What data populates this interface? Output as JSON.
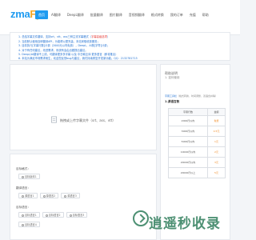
{
  "header": {
    "logo_main": "zma",
    "logo_accent": "Fy",
    "nav": [
      "首页",
      "AI翻译",
      "DeepL翻译",
      "批量翻译",
      "图片翻译",
      "音视频翻译",
      "格式转换",
      "我的订单",
      "充值",
      "帮助"
    ]
  },
  "notice": {
    "lines": [
      "1. 总结字幕文件翻译，支持srt、vtt、ass三种主流字幕格式（",
      "2. 当前默认使用自研翻译API，为能得以更完善，本站采取收费服务；",
      "3. 目前执行[字幕行数]计费（2000元以内免费），DeepL、AI按[字符]计费；",
      "4. 对于有任何建议，改进需求，系统有会由出题提出建议。",
      "5. DeepL/AI翻译不上线，可翻译更多多字幕 以及 中日韩互译 更多语言（即将推出）",
      "6. 本站为满足市场需求而生，欢迎您反馈bug与建议，我们持续修复开发新功能。QQ：2132781715"
    ],
    "highlight": "字幕高级选项"
  },
  "upload": {
    "hint": "拖拽或上传字幕文件（srt、ass、vtt）"
  },
  "options": {
    "format_label": "目标格式：",
    "format_items": [
      "目标版本1"
    ],
    "lang_label": "翻译语言：",
    "lang_items": [
      "源语言1",
      "源语言2",
      "源语言3"
    ],
    "target_label": "目标语言：",
    "target_items": [
      "目标语言1",
      "目标语言2",
      "目标语言3",
      "目标语言4"
    ]
  },
  "help": {
    "title": "帮助说明",
    "subtitle": "1. 如何使用",
    "note_link": "字幕工具栏",
    "note_rest": "（格式转换、时间调整、双语合并等）",
    "section": "1.源语言数",
    "headers": [
      "字幕行数",
      "金额"
    ],
    "rows": [
      [
        "2000行以内",
        "免费"
      ],
      [
        "3000行以内",
        "0.5元"
      ],
      [
        "5000行以内",
        "1元"
      ],
      [
        "10000行以内",
        "2元"
      ],
      [
        "20000行以内",
        "3元"
      ],
      [
        "20000行以上",
        "5元"
      ]
    ]
  },
  "watermark": {
    "text": "逍遥秒收录"
  },
  "colors": {
    "accent": "#1f9bf0",
    "price": "#f08a24",
    "watermark": "#2e7d5b"
  }
}
